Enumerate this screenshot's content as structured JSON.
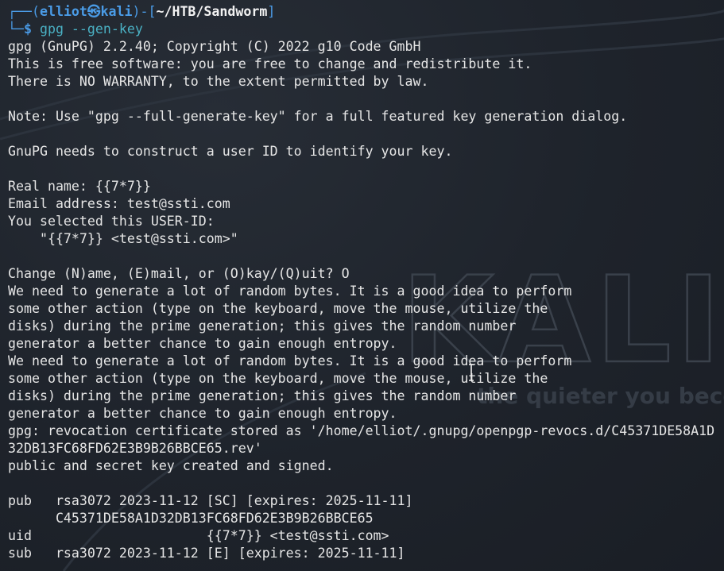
{
  "prompt": {
    "box_top": "┌──(",
    "user": "elliot",
    "at_symbol": "㉿",
    "host": "kali",
    "sep": ")-[",
    "path": "~/HTB/Sandworm",
    "close": "]",
    "box_bottom": "└─",
    "dollar": "$",
    "command": " gpg --gen-key"
  },
  "output_lines": [
    "gpg (GnuPG) 2.2.40; Copyright (C) 2022 g10 Code GmbH",
    "This is free software: you are free to change and redistribute it.",
    "There is NO WARRANTY, to the extent permitted by law.",
    "",
    "Note: Use \"gpg --full-generate-key\" for a full featured key generation dialog.",
    "",
    "GnuPG needs to construct a user ID to identify your key.",
    "",
    "Real name: {{7*7}}",
    "Email address: test@ssti.com",
    "You selected this USER-ID:",
    "    \"{{7*7}} <test@ssti.com>\"",
    "",
    "Change (N)ame, (E)mail, or (O)kay/(Q)uit? O",
    "We need to generate a lot of random bytes. It is a good idea to perform",
    "some other action (type on the keyboard, move the mouse, utilize the",
    "disks) during the prime generation; this gives the random number",
    "generator a better chance to gain enough entropy.",
    "We need to generate a lot of random bytes. It is a good idea to perform",
    "some other action (type on the keyboard, move the mouse, utilize the",
    "disks) during the prime generation; this gives the random number",
    "generator a better chance to gain enough entropy.",
    "gpg: revocation certificate stored as '/home/elliot/.gnupg/openpgp-revocs.d/C45371DE58A1D",
    "32DB13FC68FD62E3B9B26BBCE65.rev'",
    "public and secret key created and signed.",
    "",
    "pub   rsa3072 2023-11-12 [SC] [expires: 2025-11-11]",
    "      C45371DE58A1D32DB13FC68FD62E3B9B26BBCE65",
    "uid                      {{7*7}} <test@ssti.com>",
    "sub   rsa3072 2023-11-12 [E] [expires: 2025-11-11]"
  ],
  "wallpaper": {
    "logo_text": "KALI",
    "tagline": "the quieter you become,"
  },
  "colors": {
    "background": "#1f242c",
    "prompt_blue": "#4a9be6",
    "prompt_green": "#2bb34f",
    "command_cyan": "#4ab1c4",
    "text": "#e6e6e6"
  }
}
